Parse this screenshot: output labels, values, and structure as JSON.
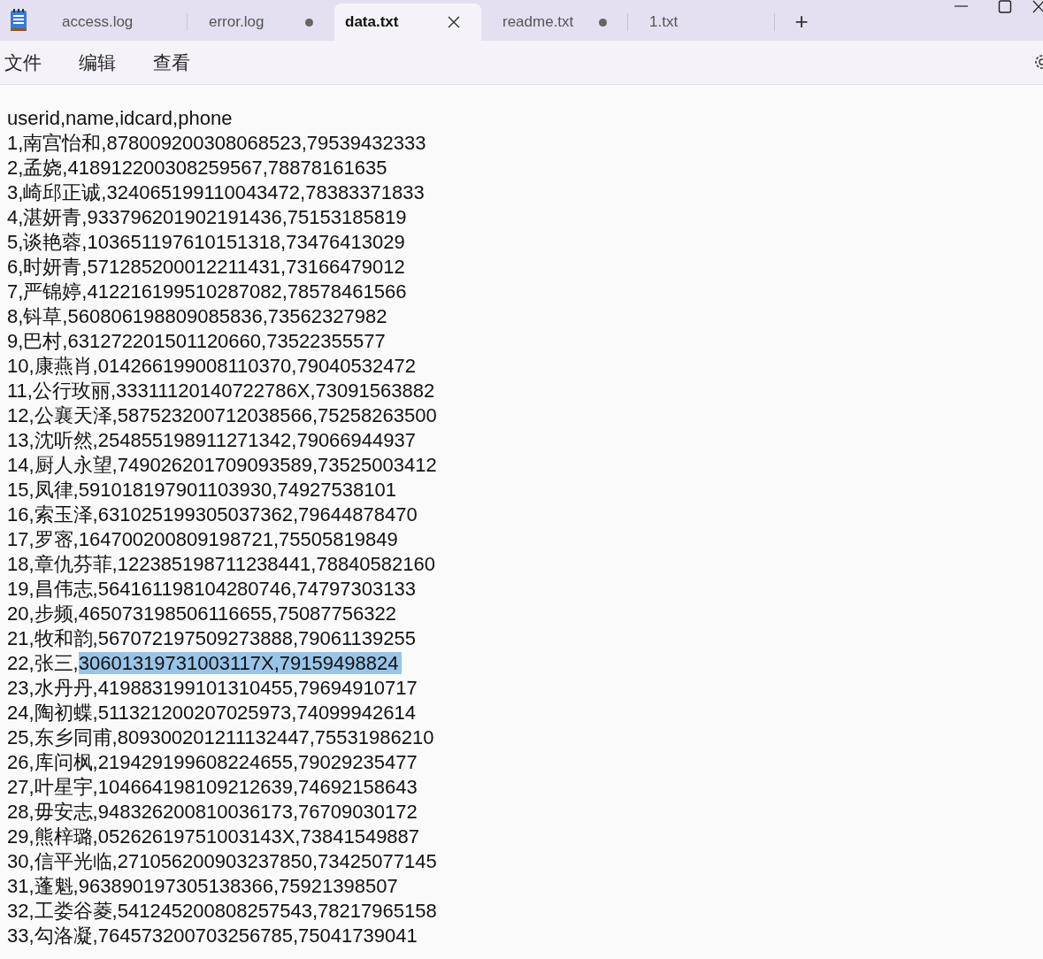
{
  "tabs": [
    {
      "label": "access.log",
      "selected": false,
      "modified": false
    },
    {
      "label": "error.log",
      "selected": false,
      "modified": true
    },
    {
      "label": "data.txt",
      "selected": true,
      "modified": false
    },
    {
      "label": "readme.txt",
      "selected": false,
      "modified": true
    },
    {
      "label": "1.txt",
      "selected": false,
      "modified": false
    }
  ],
  "new_tab": "+",
  "menu": [
    "文件",
    "编辑",
    "查看"
  ],
  "lines": [
    {
      "text": "userid,name,idcard,phone"
    },
    {
      "text": "1,南宫怡和,878009200308068523,79539432333"
    },
    {
      "text": "2,孟娆,418912200308259567,78878161635"
    },
    {
      "text": "3,崎邱正诚,324065199110043472,78383371833"
    },
    {
      "text": "4,湛妍青,933796201902191436,75153185819"
    },
    {
      "text": "5,谈艳蓉,103651197610151318,73476413029"
    },
    {
      "text": "6,时妍青,571285200012211431,73166479012"
    },
    {
      "text": "7,严锦婷,412216199510287082,78578461566"
    },
    {
      "text": "8,钭草,560806198809085836,73562327982"
    },
    {
      "text": "9,巴村,631272201501120660,73522355577"
    },
    {
      "text": "10,康燕肖,014266199008110370,79040532472"
    },
    {
      "text": "11,公行玫丽,33311120140722786X,73091563882"
    },
    {
      "text": "12,公襄天泽,587523200712038566,75258263500"
    },
    {
      "text": "13,沈听然,254855198911271342,79066944937"
    },
    {
      "text": "14,厨人永望,749026201709093589,73525003412"
    },
    {
      "text": "15,凤律,591018197901103930,74927538101"
    },
    {
      "text": "16,索玉泽,631025199305037362,79644878470"
    },
    {
      "text": "17,罗宻,164700200809198721,75505819849"
    },
    {
      "text": "18,章仇芬菲,122385198711238441,78840582160"
    },
    {
      "text": "19,昌伟志,564161198104280746,74797303133"
    },
    {
      "text": "20,步频,465073198506116655,75087756322"
    },
    {
      "text": "21,牧和韵,567072197509273888,79061139255"
    },
    {
      "text": "22,张三,",
      "selection": "30601319731003117X,79159498824"
    },
    {
      "text": "23,水丹丹,419883199101310455,79694910717"
    },
    {
      "text": "24,陶初蝶,511321200207025973,74099942614"
    },
    {
      "text": "25,东乡同甫,809300201211132447,75531986210"
    },
    {
      "text": "26,库问枫,219429199608224655,79029235477"
    },
    {
      "text": "27,叶星宇,104664198109212639,74692158643"
    },
    {
      "text": "28,毋安志,948326200810036173,76709030172"
    },
    {
      "text": "29,熊梓璐,05262619751003143X,73841549887"
    },
    {
      "text": "30,信平光临,271056200903237850,73425077145"
    },
    {
      "text": "31,蓬魁,963890197305138366,75921398507"
    },
    {
      "text": "32,工娄谷菱,541245200808257543,78217965158"
    },
    {
      "text": "33,勾洛凝,764573200703256785,75041739041"
    }
  ]
}
